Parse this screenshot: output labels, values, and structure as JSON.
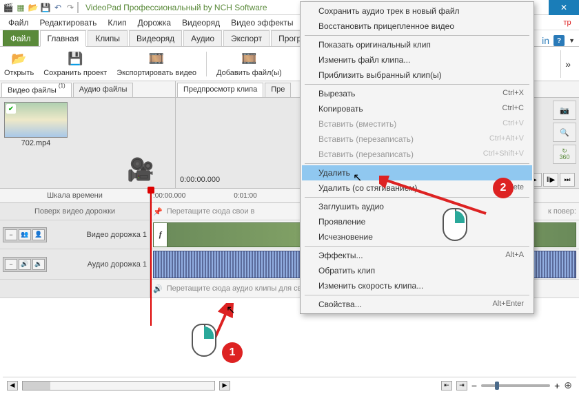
{
  "titlebar": {
    "title": "VideoPad Профессиональный by NCH Software"
  },
  "menubar": {
    "items": [
      "Файл",
      "Редактировать",
      "Клип",
      "Дорожка",
      "Видеоряд",
      "Видео эффекты"
    ]
  },
  "tabs": {
    "file": "Файл",
    "items": [
      "Главная",
      "Клипы",
      "Видеоряд",
      "Аудио",
      "Экспорт",
      "Программы"
    ]
  },
  "ribbon": {
    "open": "Открыть",
    "save": "Сохранить проект",
    "export": "Экспортировать видео",
    "add": "Добавить файл(ы)"
  },
  "bin": {
    "video_tab": "Видео файлы",
    "video_count": "(1)",
    "audio_tab": "Аудио файлы",
    "clip_name": "702.mp4"
  },
  "preview": {
    "tab1": "Предпросмотр клипа",
    "tab2": "Пре",
    "time": "0:00:00.000",
    "r360": "360"
  },
  "timeline": {
    "scale_label": "Шкала времени",
    "t0": ":00:00.000",
    "t1": "0:01:00",
    "overlay_label": "Поверх видео дорожки",
    "overlay_hint": "Перетащите сюда свои в",
    "overlay_hint2": "к повер:",
    "video_track": "Видео дорожка 1",
    "audio_track": "Аудио дорожка 1",
    "audio_drop": "Перетащите сюда аудио клипы для сведения"
  },
  "context_menu": {
    "save_audio": "Сохранить аудио трек в новый файл",
    "restore_video": "Восстановить прицепленное видео",
    "show_original": "Показать оригинальный клип",
    "change_file": "Изменить файл клипа...",
    "zoom_selected": "Приблизить выбранный клип(ы)",
    "cut": "Вырезать",
    "cut_sc": "Ctrl+X",
    "copy": "Копировать",
    "copy_sc": "Ctrl+C",
    "paste_fit": "Вставить (вместить)",
    "paste_fit_sc": "Ctrl+V",
    "paste_over": "Вставить (перезаписать)",
    "paste_over_sc": "Ctrl+Alt+V",
    "paste_ins": "Вставить (перезаписать)",
    "paste_ins_sc": "Ctrl+Shift+V",
    "delete": "Удалить",
    "delete_ripple": "Удалить (со стягиванием)",
    "delete_ripple_sc": "Delete",
    "mute": "Заглушить аудио",
    "fadein": "Проявление",
    "fadeout": "Исчезновение",
    "effects": "Эффекты...",
    "effects_sc": "Alt+A",
    "reverse": "Обратить клип",
    "speed": "Изменить скорость клипа...",
    "props": "Свойства...",
    "props_sc": "Alt+Enter"
  },
  "annotations": {
    "badge1": "1",
    "badge2": "2"
  }
}
